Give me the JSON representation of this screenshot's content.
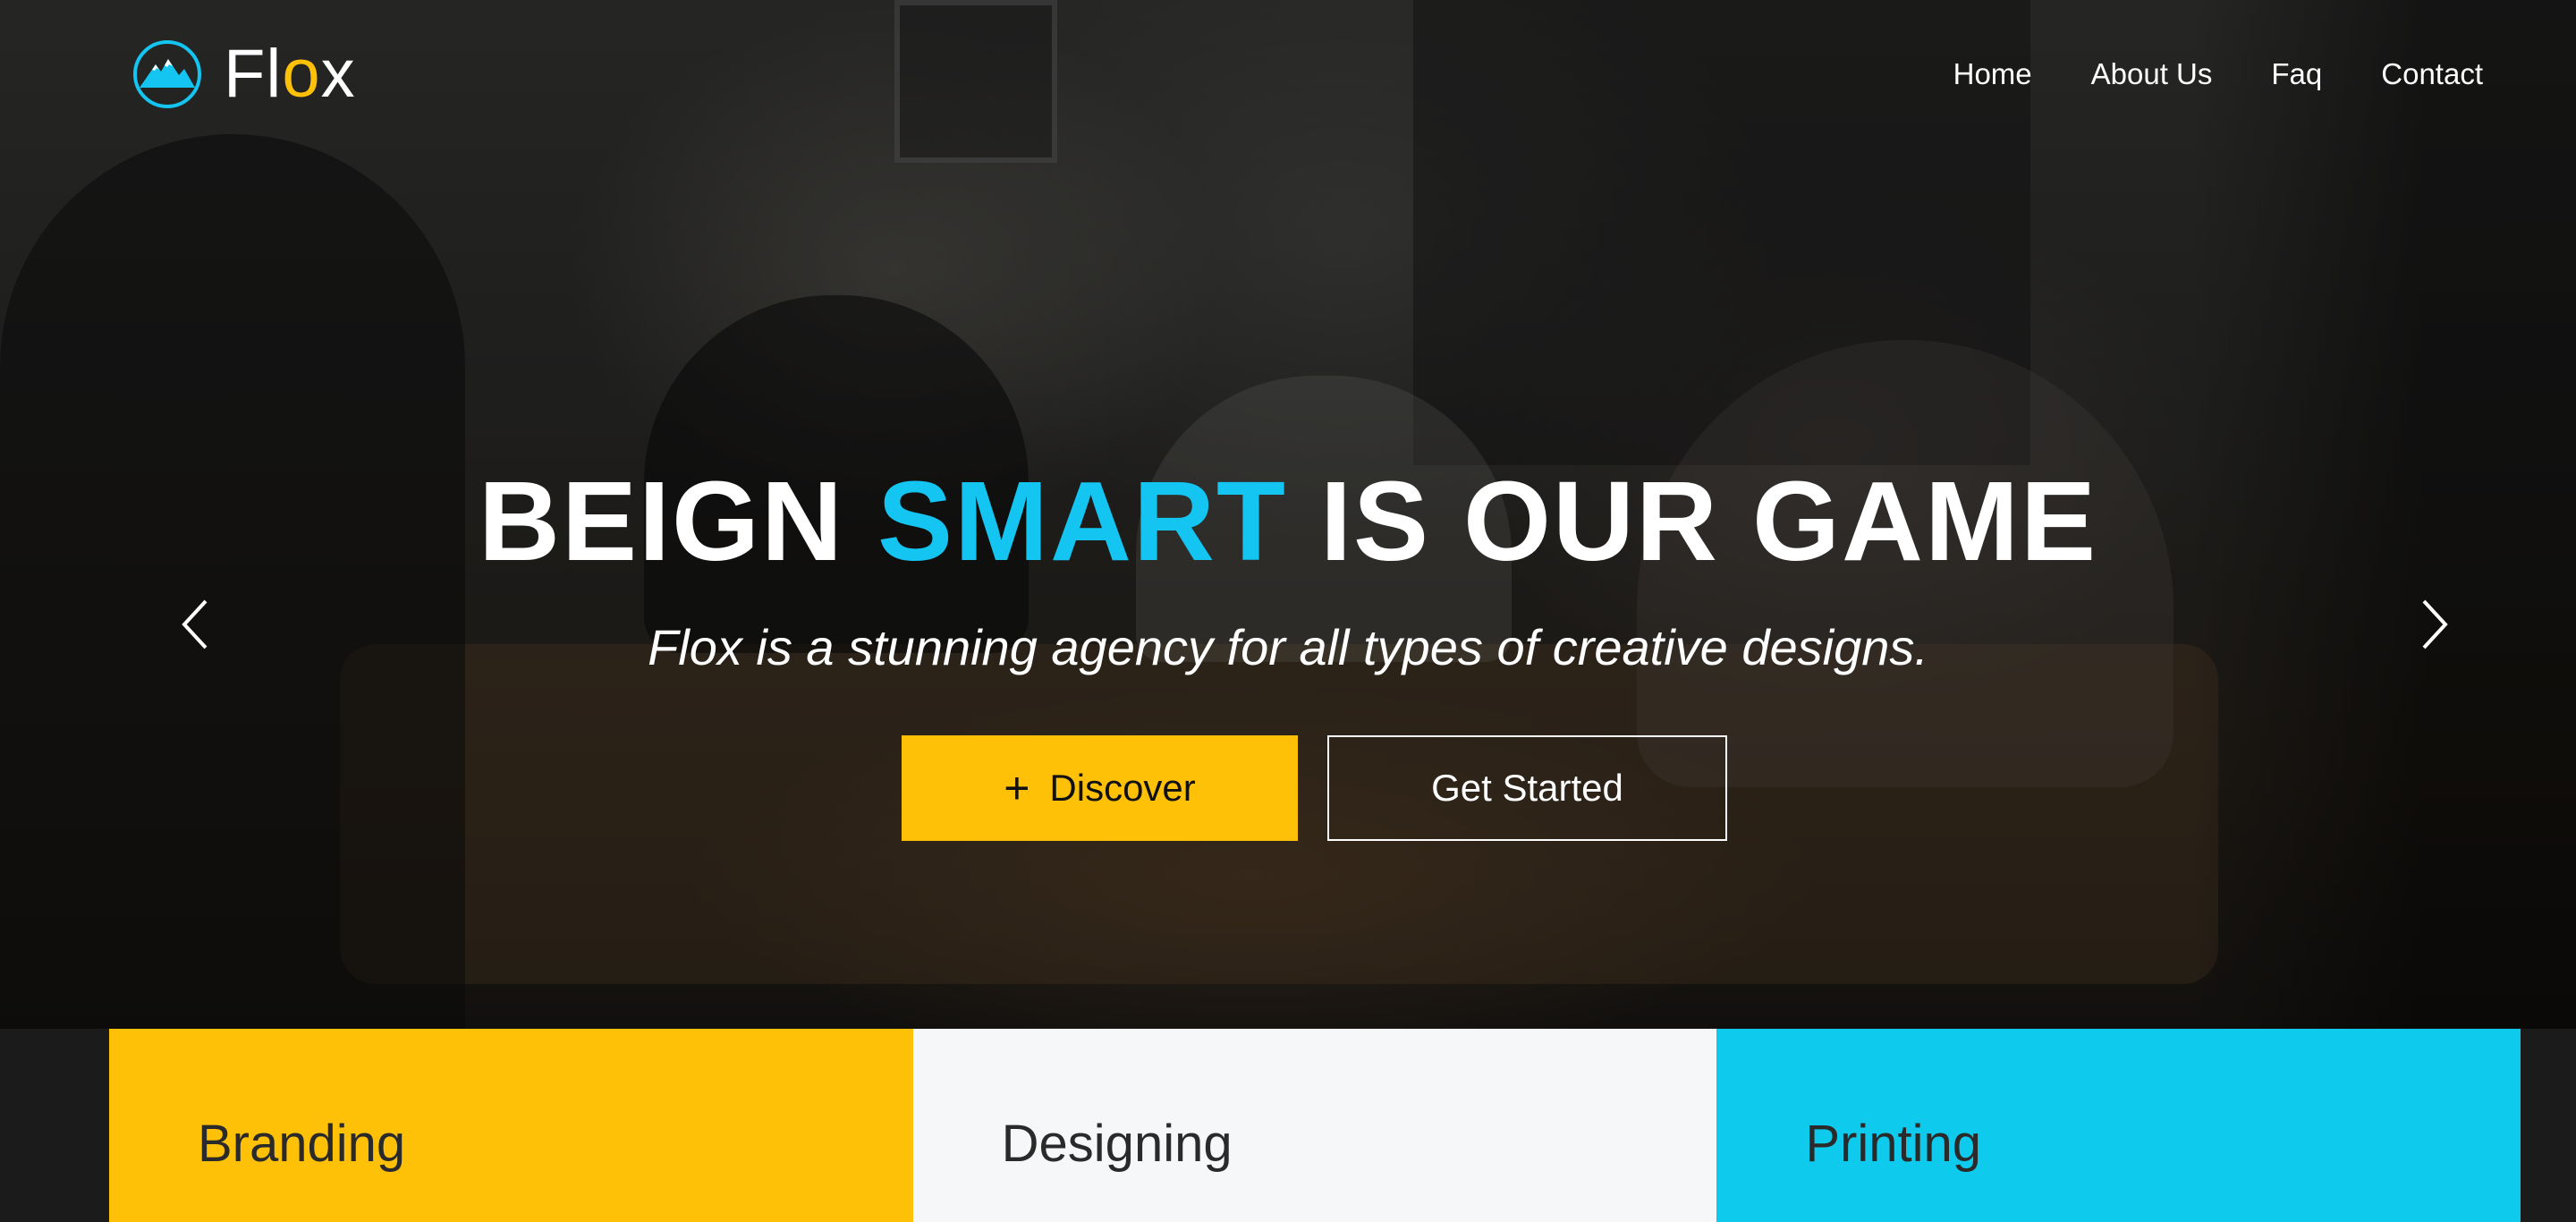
{
  "brand": {
    "name_prefix": "Fl",
    "name_accent": "o",
    "name_suffix": "x",
    "logo_icon": "mountain-logo-icon",
    "accent_color": "#ffc107",
    "primary_color": "#13c5f0"
  },
  "nav": {
    "items": [
      {
        "label": "Home"
      },
      {
        "label": "About Us"
      },
      {
        "label": "Faq"
      },
      {
        "label": "Contact"
      }
    ]
  },
  "hero": {
    "headline_part1": "BEIGN",
    "headline_accent": "SMART",
    "headline_part2": "IS OUR GAME",
    "subheadline": "Flox is a stunning agency for all types of creative designs.",
    "primary_button": {
      "icon": "plus-icon",
      "label": "Discover"
    },
    "secondary_button": {
      "label": "Get Started"
    },
    "prev_icon": "chevron-left-icon",
    "next_icon": "chevron-right-icon"
  },
  "services": [
    {
      "label": "Branding",
      "color": "#ffc107"
    },
    {
      "label": "Designing",
      "color": "#f6f7f9"
    },
    {
      "label": "Printing",
      "color": "#0ecbed"
    }
  ]
}
